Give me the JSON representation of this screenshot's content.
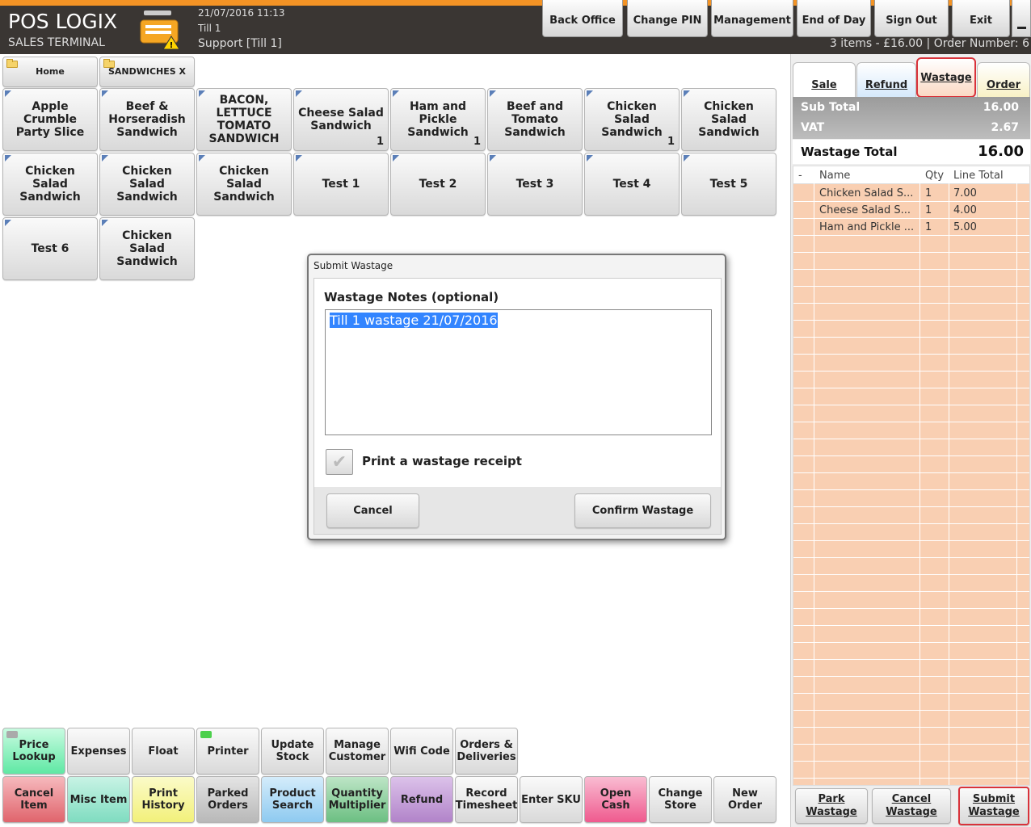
{
  "header": {
    "brand_title": "POS LOGIX",
    "brand_subtitle": "SALES TERMINAL",
    "date_time": "21/07/2016 11:13",
    "till": "Till 1",
    "user": "Support [Till 1]",
    "order_summary": "3 items - £16.00  |  Order Number: 6",
    "buttons": [
      "Back Office",
      "Change PIN",
      "Management",
      "End of Day",
      "Sign Out",
      "Exit"
    ]
  },
  "nav": {
    "home": "Home",
    "category": "SANDWICHES X"
  },
  "products": [
    {
      "label": "Apple Crumble Party Slice",
      "qty": ""
    },
    {
      "label": "Beef & Horseradish Sandwich",
      "qty": ""
    },
    {
      "label": "BACON, LETTUCE TOMATO SANDWICH",
      "qty": ""
    },
    {
      "label": "Cheese Salad Sandwich",
      "qty": "1"
    },
    {
      "label": "Ham and Pickle Sandwich",
      "qty": "1"
    },
    {
      "label": "Beef and Tomato Sandwich",
      "qty": ""
    },
    {
      "label": "Chicken Salad Sandwich",
      "qty": "1"
    },
    {
      "label": "Chicken Salad Sandwich",
      "qty": ""
    },
    {
      "label": "Chicken Salad Sandwich",
      "qty": ""
    },
    {
      "label": "Chicken Salad Sandwich",
      "qty": ""
    },
    {
      "label": "Chicken Salad Sandwich",
      "qty": ""
    },
    {
      "label": "Test 1",
      "qty": ""
    },
    {
      "label": "Test 2",
      "qty": ""
    },
    {
      "label": "Test 3",
      "qty": ""
    },
    {
      "label": "Test 4",
      "qty": ""
    },
    {
      "label": "Test 5",
      "qty": ""
    },
    {
      "label": "Test 6",
      "qty": ""
    },
    {
      "label": "Chicken Salad Sandwich",
      "qty": ""
    }
  ],
  "function_row1": [
    {
      "label": "Price Lookup",
      "color": "#5fe8a4"
    },
    {
      "label": "Expenses",
      "color": ""
    },
    {
      "label": "Float",
      "color": ""
    },
    {
      "label": "Printer",
      "color": ""
    },
    {
      "label": "Update Stock",
      "color": ""
    },
    {
      "label": "Manage Customer",
      "color": ""
    },
    {
      "label": "Wifi Code",
      "color": ""
    },
    {
      "label": "Orders & Deliveries",
      "color": ""
    }
  ],
  "function_row2": [
    {
      "label": "Cancel Item",
      "color": "#e0646c"
    },
    {
      "label": "Misc Item",
      "color": "#7fdcc0"
    },
    {
      "label": "Print History",
      "color": "#f2f07a"
    },
    {
      "label": "Parked Orders",
      "color": "#b8b8b8"
    },
    {
      "label": "Product Search",
      "color": "#8ecaf0"
    },
    {
      "label": "Quantity Multiplier",
      "color": "#6cbf82"
    },
    {
      "label": "Refund",
      "color": "#b183c9"
    },
    {
      "label": "Record Timesheet",
      "color": ""
    },
    {
      "label": "Enter SKU",
      "color": ""
    },
    {
      "label": "Open Cash",
      "color": "#ef5a8e"
    },
    {
      "label": "Change Store",
      "color": ""
    },
    {
      "label": "New Order",
      "color": ""
    }
  ],
  "panel": {
    "tabs": [
      "Sale",
      "Refund",
      "Wastage",
      "Order"
    ],
    "active_tab": "Wastage",
    "subtotal_label": "Sub Total",
    "subtotal_value": "16.00",
    "vat_label": "VAT",
    "vat_value": "2.67",
    "wastage_total_label": "Wastage Total",
    "wastage_total_value": "16.00",
    "columns": [
      "-",
      "Name",
      "Qty",
      "Line Total"
    ],
    "rows": [
      {
        "name": "Chicken Salad S...",
        "qty": "1",
        "total": "7.00"
      },
      {
        "name": "Cheese Salad S...",
        "qty": "1",
        "total": "4.00"
      },
      {
        "name": "Ham and Pickle ...",
        "qty": "1",
        "total": "5.00"
      }
    ],
    "bottom_buttons": [
      "Park Wastage",
      "Cancel Wastage",
      "Submit Wastage"
    ]
  },
  "dialog": {
    "title": "Submit Wastage",
    "notes_label": "Wastage Notes (optional)",
    "notes_value": "Till 1 wastage 21/07/2016",
    "checkbox_label": "Print a wastage receipt",
    "cancel": "Cancel",
    "confirm": "Confirm Wastage"
  },
  "colors": {
    "accent_orange": "#f39325",
    "header_bg": "#3a3633",
    "grid_bg": "#f9cfb2",
    "highlight_border": "#d9323a",
    "printer_led": "#4cd04c",
    "price_led": "#aaaaaa"
  }
}
